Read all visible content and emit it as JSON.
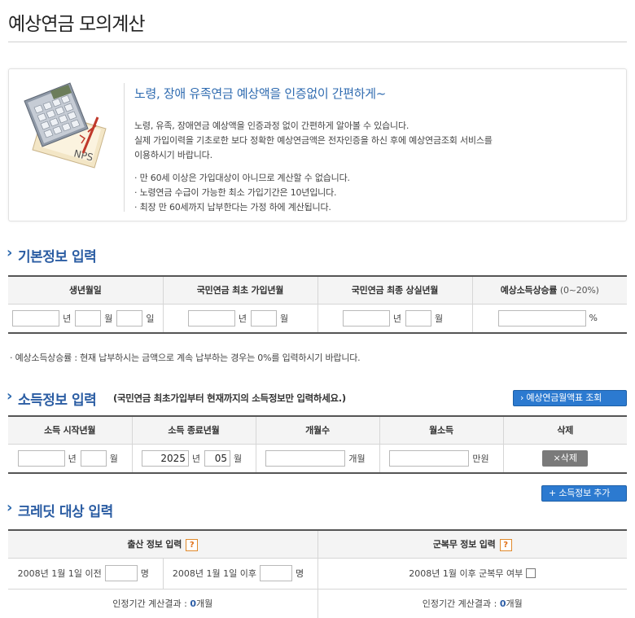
{
  "page_title": "예상연금 모의계산",
  "info": {
    "heading": "노령, 장애 유족연금 예상액을 인증없이 간편하게~",
    "para1": "노령, 유족, 장애연금 예상액을 인증과정 없이 간편하게 알아볼 수 있습니다.",
    "para2": "실제 가입이력을 기초로한 보다 정확한 예상연금액은 전자인증을 하신 후에 예상연금조회 서비스를",
    "para3": "이용하시기 바랍니다.",
    "bullets": [
      "· 만 60세 이상은 가입대상이 아니므로 계산할 수 없습니다.",
      "· 노령연금 수급이 가능한 최소 가입기간은 10년입니다.",
      "· 최장 만 60세까지 납부한다는 가정 하에 계산됩니다."
    ],
    "illustration_text": "NPS"
  },
  "basic": {
    "title": "기본정보 입력",
    "headers": [
      "생년월일",
      "국민연금 최초 가입년월",
      "국민연금 최종 상실년월",
      "예상소득상승률"
    ],
    "rate_hint": "(0~20%)",
    "units": {
      "year": "년",
      "month": "월",
      "day": "일",
      "percent": "%"
    },
    "note": "· 예상소득상승률 : 현재 납부하시는 금액으로 계속 납부하는 경우는 0%를 입력하시기 바랍니다."
  },
  "income": {
    "title": "소득정보 입력",
    "subtitle": "(국민연금 최초가입부터 현재까지의 소득정보만 입력하세요.)",
    "table_button": "› 예상연금월액표 조회",
    "headers": [
      "소득 시작년월",
      "소득 종료년월",
      "개월수",
      "월소득",
      "삭제"
    ],
    "row": {
      "end_year": "2025",
      "end_month": "05",
      "unit_months": "개월",
      "unit_income": "만원",
      "delete_label": "×삭제"
    },
    "add_button": "+ 소득정보 추가"
  },
  "credit": {
    "title": "크레딧 대상 입력",
    "birth_header": "출산 정보 입력",
    "military_header": "군복무 정보 입력",
    "help_glyph": "?",
    "birth_before": "2008년 1월 1일 이전",
    "birth_after": "2008년 1월 1일 이후",
    "unit_people": "명",
    "military_label": "2008년 1월 이후 군복무 여부",
    "result_label": "인정기간 계산결과 :",
    "birth_result": "0",
    "military_result": "0",
    "result_unit": "개월"
  },
  "colors": {
    "accent": "#2b5da3",
    "button": "#2c7ad0",
    "help": "#e07018"
  }
}
